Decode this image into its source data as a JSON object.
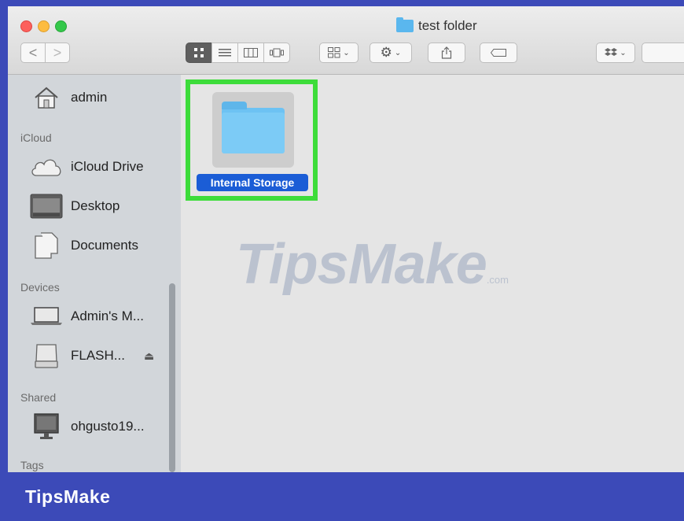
{
  "window": {
    "title": "test folder"
  },
  "toolbar": {
    "back_glyph": "<",
    "forward_glyph": ">",
    "view_buttons": [
      "icon-view",
      "list-view",
      "column-view",
      "cover-flow-view"
    ],
    "arrange_icon": "grid-arrange-icon",
    "action_icon": "gear-icon",
    "share_icon": "share-icon",
    "tag_icon": "tag-icon",
    "dropbox_icon": "dropbox-icon"
  },
  "sidebar": {
    "items_top": [
      {
        "label": "admin",
        "icon": "home-icon"
      }
    ],
    "sections": {
      "icloud": "iCloud",
      "devices": "Devices",
      "shared": "Shared",
      "tags": "Tags"
    },
    "icloud_items": [
      {
        "label": "iCloud Drive",
        "icon": "cloud-icon"
      },
      {
        "label": "Desktop",
        "icon": "desktop-icon"
      },
      {
        "label": "Documents",
        "icon": "documents-icon"
      }
    ],
    "device_items": [
      {
        "label": "Admin's M...",
        "icon": "laptop-icon"
      },
      {
        "label": "FLASH...",
        "icon": "drive-icon",
        "eject": "⏏"
      }
    ],
    "shared_items": [
      {
        "label": "ohgusto19...",
        "icon": "monitor-icon"
      }
    ]
  },
  "content": {
    "items": [
      {
        "name": "Internal Storage",
        "icon": "folder-icon",
        "selected": true
      }
    ]
  },
  "watermark": {
    "text": "TipsMake",
    "suffix": ".com"
  },
  "banner": {
    "text": "TipsMake"
  },
  "colors": {
    "frame": "#3c4ab8",
    "highlight": "#3ddc3a",
    "selection": "#1b5dd6",
    "folder": "#6dc2f3"
  }
}
